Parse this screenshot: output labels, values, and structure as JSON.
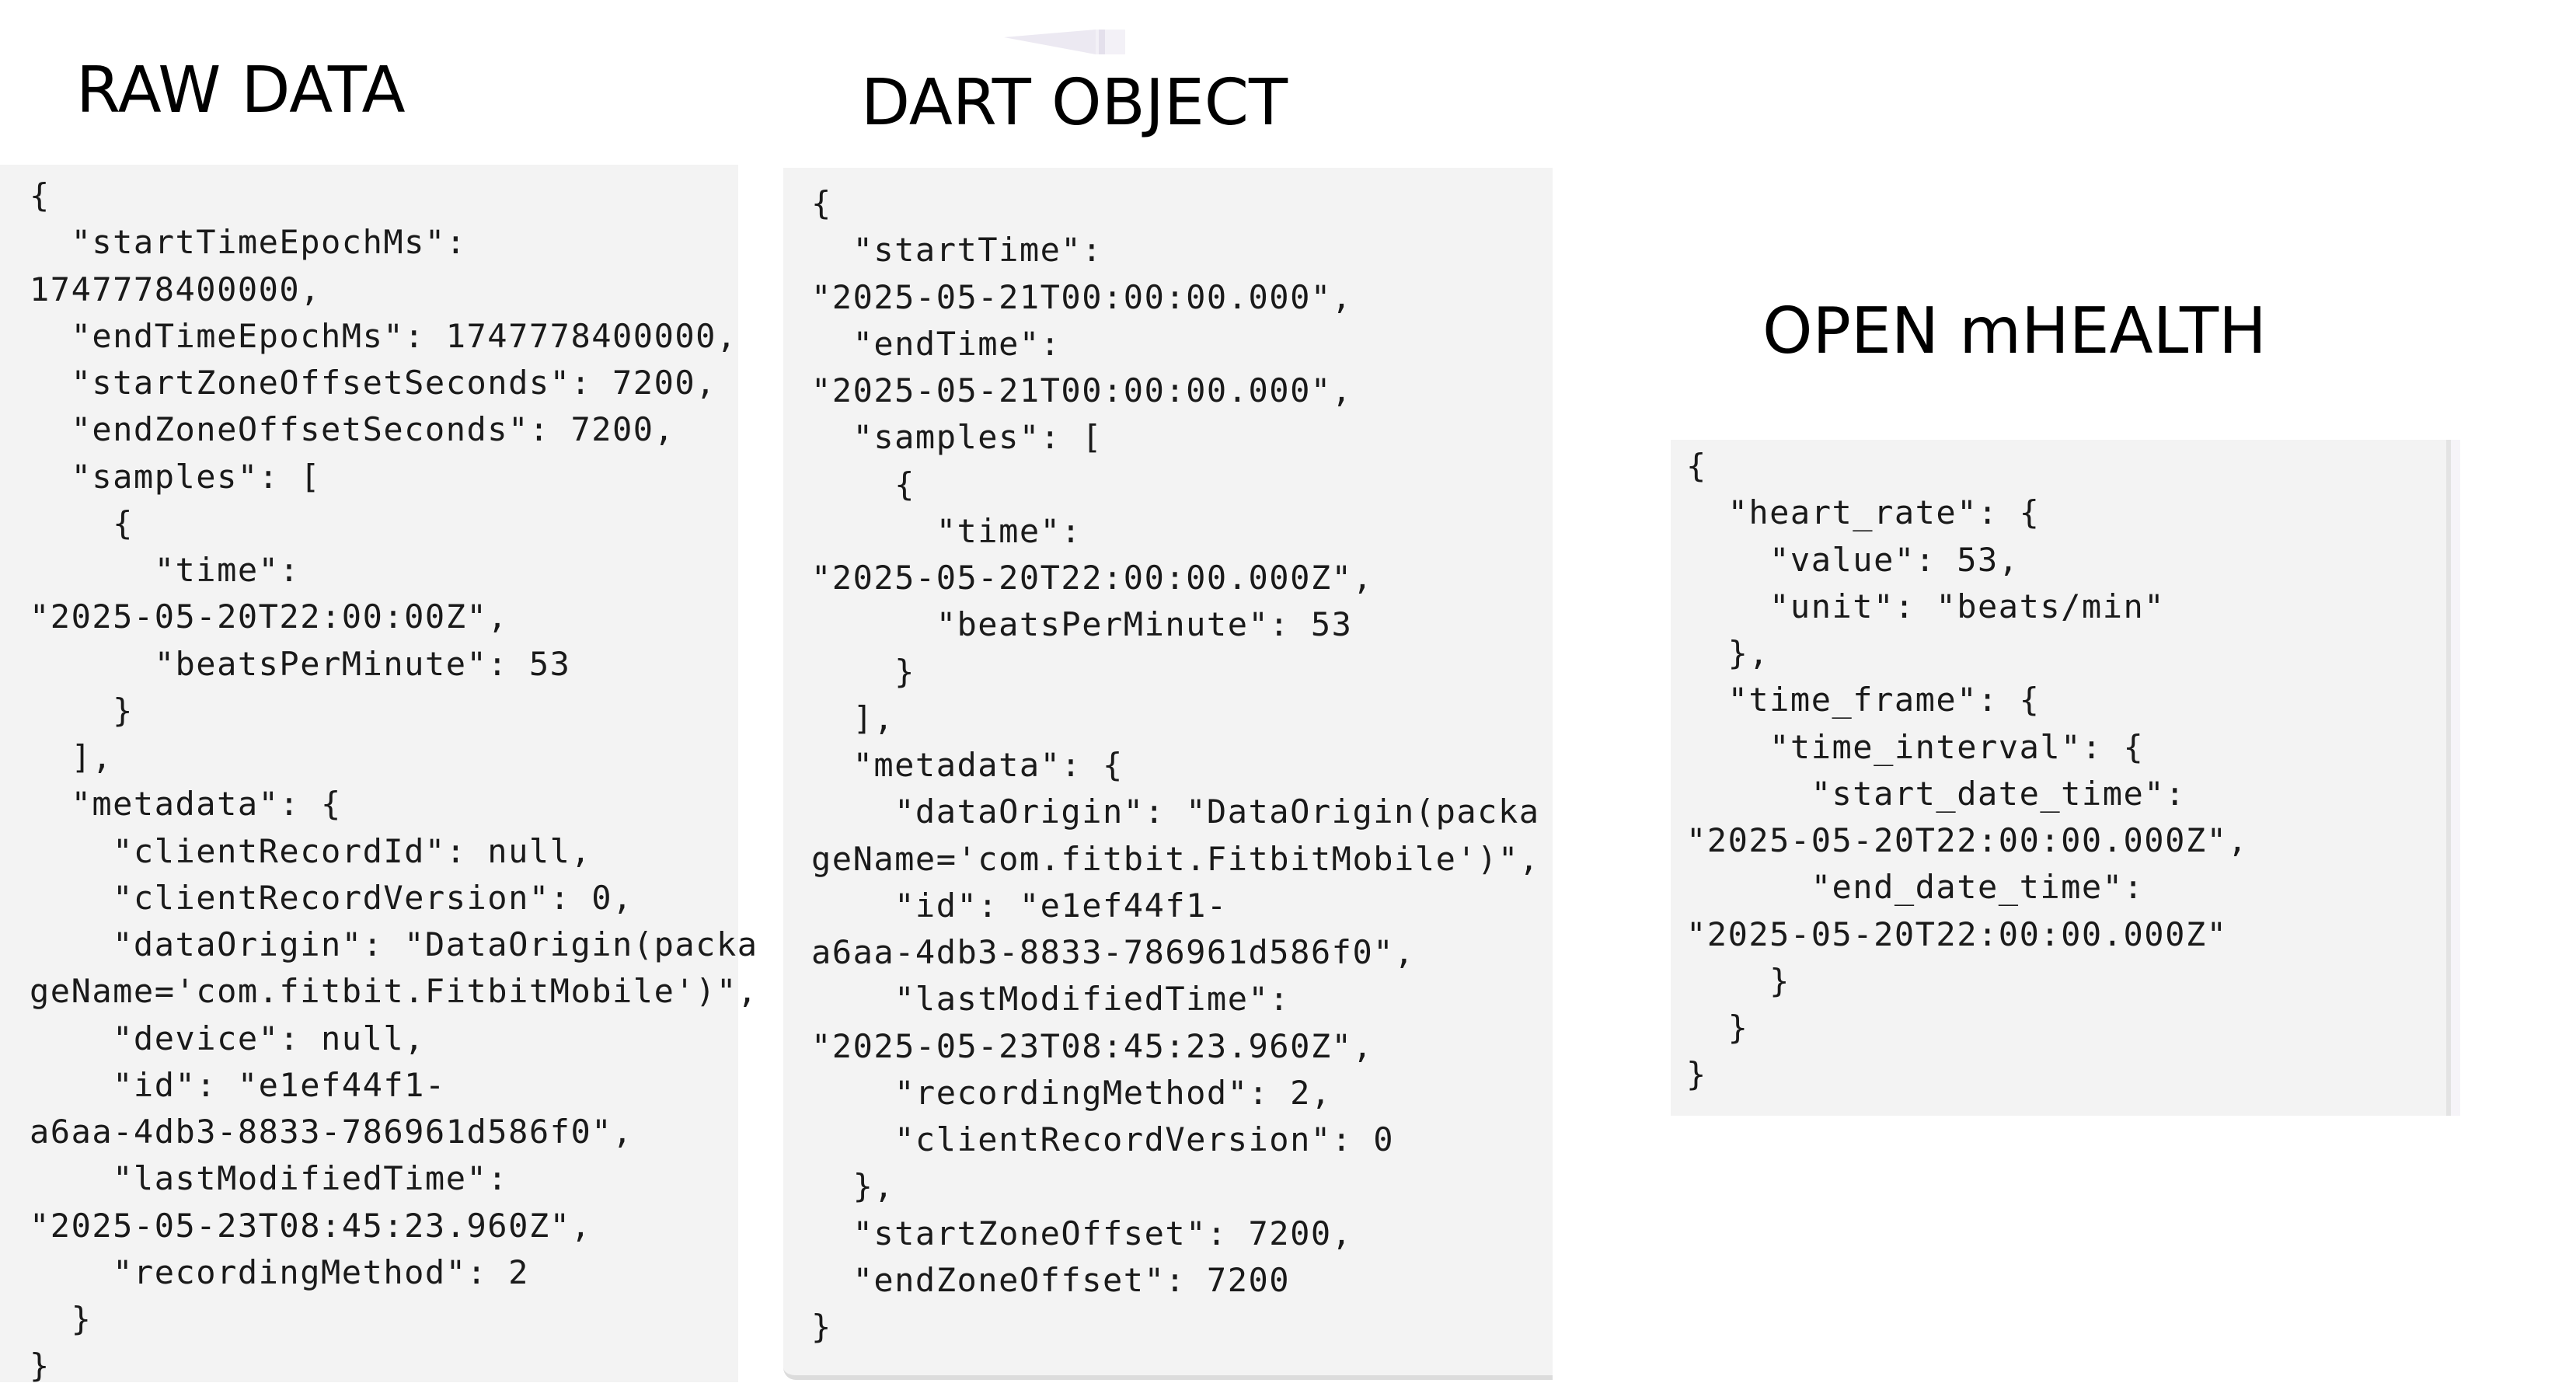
{
  "sections": {
    "raw": {
      "title": "RAW DATA",
      "code": "{\n  \"startTimeEpochMs\":\n1747778400000,\n  \"endTimeEpochMs\": 1747778400000,\n  \"startZoneOffsetSeconds\": 7200,\n  \"endZoneOffsetSeconds\": 7200,\n  \"samples\": [\n    {\n      \"time\":\n\"2025-05-20T22:00:00Z\",\n      \"beatsPerMinute\": 53\n    }\n  ],\n  \"metadata\": {\n    \"clientRecordId\": null,\n    \"clientRecordVersion\": 0,\n    \"dataOrigin\": \"DataOrigin(packa\ngeName='com.fitbit.FitbitMobile')\",\n    \"device\": null,\n    \"id\": \"e1ef44f1-\na6aa-4db3-8833-786961d586f0\",\n    \"lastModifiedTime\":\n\"2025-05-23T08:45:23.960Z\",\n    \"recordingMethod\": 2\n  }\n}"
    },
    "dart": {
      "title": "DART OBJECT",
      "code": "{\n  \"startTime\":\n\"2025-05-21T00:00:00.000\",\n  \"endTime\":\n\"2025-05-21T00:00:00.000\",\n  \"samples\": [\n    {\n      \"time\":\n\"2025-05-20T22:00:00.000Z\",\n      \"beatsPerMinute\": 53\n    }\n  ],\n  \"metadata\": {\n    \"dataOrigin\": \"DataOrigin(packa\ngeName='com.fitbit.FitbitMobile')\",\n    \"id\": \"e1ef44f1-\na6aa-4db3-8833-786961d586f0\",\n    \"lastModifiedTime\":\n\"2025-05-23T08:45:23.960Z\",\n    \"recordingMethod\": 2,\n    \"clientRecordVersion\": 0\n  },\n  \"startZoneOffset\": 7200,\n  \"endZoneOffset\": 7200\n}"
    },
    "omh": {
      "title": "OPEN mHEALTH",
      "code": "{\n  \"heart_rate\": {\n    \"value\": 53,\n    \"unit\": \"beats/min\"\n  },\n  \"time_frame\": {\n    \"time_interval\": {\n      \"start_date_time\":\n\"2025-05-20T22:00:00.000Z\",\n      \"end_date_time\":\n\"2025-05-20T22:00:00.000Z\"\n    }\n  }\n}"
    }
  },
  "colors": {
    "panel_background": "#f3f3f3",
    "code_text": "#1a1a1a",
    "title_text": "#000000"
  }
}
